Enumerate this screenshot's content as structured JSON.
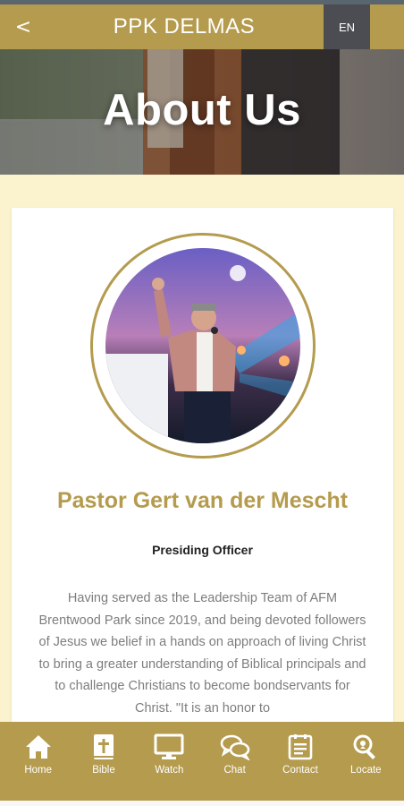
{
  "app": {
    "title": "PPK DELMAS",
    "back_label": "<",
    "language": "EN"
  },
  "hero": {
    "title": "About Us"
  },
  "profile": {
    "name": "Pastor Gert van der Mescht",
    "role": "Presiding Officer",
    "bio": "Having served as the Leadership Team of AFM Brentwood Park since 2019, and being devoted followers of Jesus we belief in a hands on approach of living Christ to bring a greater understanding of Biblical principals and to challenge Christians to become bondservants for Christ. \"It is an honor to"
  },
  "nav": {
    "items": [
      {
        "label": "Home",
        "icon": "home-icon"
      },
      {
        "label": "Bible",
        "icon": "bible-icon"
      },
      {
        "label": "Watch",
        "icon": "monitor-icon"
      },
      {
        "label": "Chat",
        "icon": "chat-icon"
      },
      {
        "label": "Contact",
        "icon": "contact-icon"
      },
      {
        "label": "Locate",
        "icon": "locate-icon"
      }
    ]
  },
  "colors": {
    "accent": "#b49b4e",
    "background": "#fbf2ce",
    "language_button": "#4b4d52"
  }
}
